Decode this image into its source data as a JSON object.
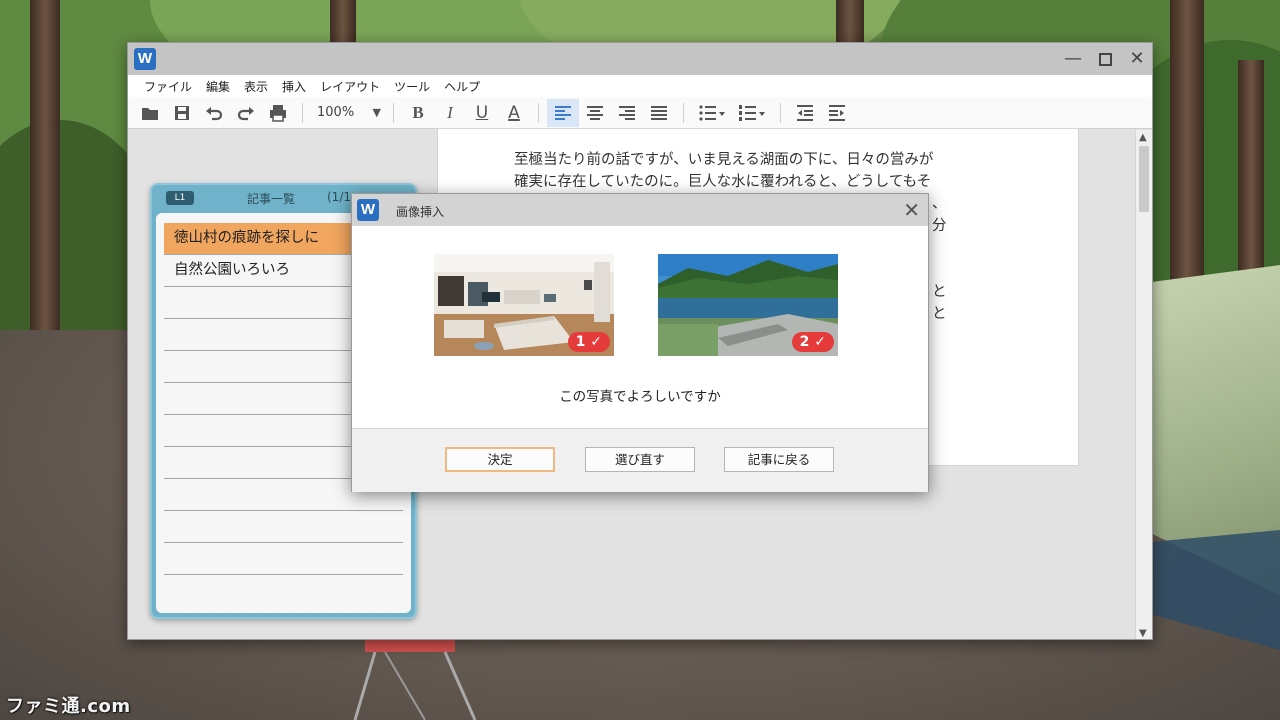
{
  "app": {
    "icon_letter": "W"
  },
  "menu": [
    "ファイル",
    "編集",
    "表示",
    "挿入",
    "レイアウト",
    "ツール",
    "ヘルプ"
  ],
  "toolbar": {
    "zoom": "100%"
  },
  "document": {
    "lines": [
      "至極当たり前の話ですが、いま見える湖面の下に、日々の営みが",
      "確実に存在していたのに。巨人な水に覆われると、どうしてもそ",
      "",
      "",
      "",
      "",
      "",
      ""
    ]
  },
  "article_list": {
    "badge": "L1",
    "title": "記事一覧",
    "count": "(1/1",
    "items": [
      "徳山村の痕跡を探しに",
      "自然公園いろいろ",
      "",
      "",
      "",
      "",
      "",
      "",
      "",
      "",
      ""
    ]
  },
  "dialog": {
    "icon_letter": "W",
    "title": "画像挿入",
    "photos": [
      {
        "badge": "1 ✓"
      },
      {
        "badge": "2 ✓"
      }
    ],
    "question": "この写真でよろしいですか",
    "buttons": {
      "ok": "決定",
      "retry": "選び直す",
      "back": "記事に戻る"
    }
  },
  "overlay_text": {
    "page_partial_1": "、",
    "page_partial_2": "分",
    "page_partial_3": "と",
    "page_partial_4": "と"
  },
  "watermark": "ファミ通.com",
  "colors": {
    "accent_blue": "#2b6fc3",
    "list_panel": "#6fb2c9",
    "selected_row": "#f0a65f",
    "check_badge": "#e53b3b"
  }
}
